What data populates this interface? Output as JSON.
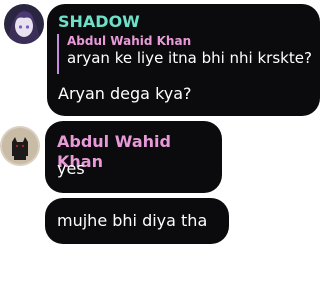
{
  "messages": [
    {
      "author": "SHADOW",
      "author_color": "#6ee0c8",
      "avatar_icon": "anime-character-avatar",
      "reply": {
        "author": "Abdul Wahid Khan",
        "author_color": "#e89ad8",
        "text": "aryan ke liye itna bhi nhi krskte?"
      },
      "text": "Aryan dega kya?"
    },
    {
      "author": "Abdul Wahid Khan",
      "author_color": "#e89ad8",
      "avatar_icon": "dark-cat-avatar",
      "lines": [
        "yes",
        "mujhe bhi diya tha"
      ]
    }
  ]
}
